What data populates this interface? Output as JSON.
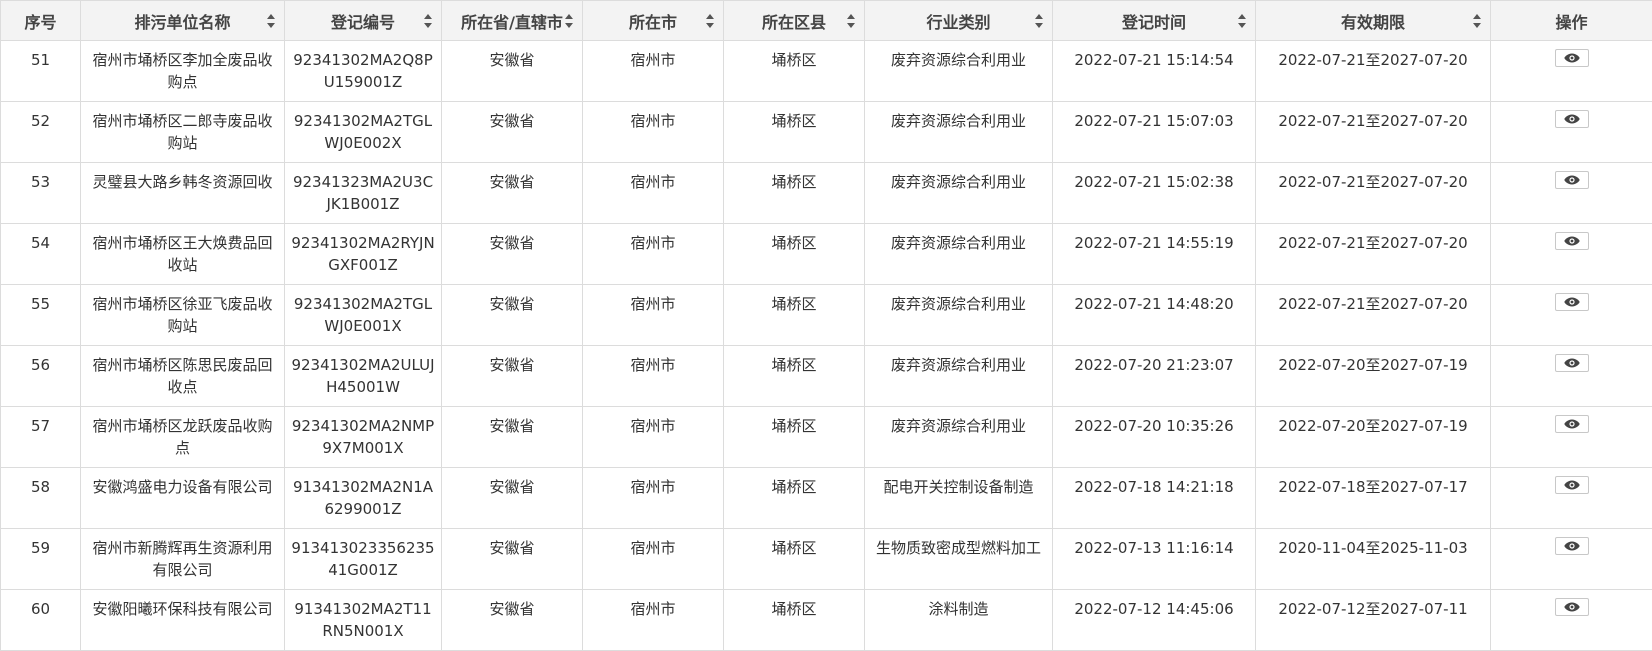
{
  "columns": [
    {
      "key": "seq",
      "label": "序号",
      "sortable": false
    },
    {
      "key": "name",
      "label": "排污单位名称",
      "sortable": true
    },
    {
      "key": "reg_no",
      "label": "登记编号",
      "sortable": true
    },
    {
      "key": "province",
      "label": "所在省/直辖市",
      "sortable": true
    },
    {
      "key": "city",
      "label": "所在市",
      "sortable": true
    },
    {
      "key": "district",
      "label": "所在区县",
      "sortable": true
    },
    {
      "key": "industry",
      "label": "行业类别",
      "sortable": true
    },
    {
      "key": "reg_time",
      "label": "登记时间",
      "sortable": true
    },
    {
      "key": "valid",
      "label": "有效期限",
      "sortable": true
    },
    {
      "key": "action",
      "label": "操作",
      "sortable": false
    }
  ],
  "icons": {
    "sort": "sort-updown-icon",
    "view": "eye-icon"
  },
  "rows": [
    {
      "seq": "51",
      "name": "宿州市埇桥区李加全废品收购点",
      "reg_no": "92341302MA2Q8PU159001Z",
      "province": "安徽省",
      "city": "宿州市",
      "district": "埇桥区",
      "industry": "废弃资源综合利用业",
      "reg_time": "2022-07-21 15:14:54",
      "valid": "2022-07-21至2027-07-20"
    },
    {
      "seq": "52",
      "name": "宿州市埇桥区二郎寺废品收购站",
      "reg_no": "92341302MA2TGLWJ0E002X",
      "province": "安徽省",
      "city": "宿州市",
      "district": "埇桥区",
      "industry": "废弃资源综合利用业",
      "reg_time": "2022-07-21 15:07:03",
      "valid": "2022-07-21至2027-07-20"
    },
    {
      "seq": "53",
      "name": "灵璧县大路乡韩冬资源回收",
      "reg_no": "92341323MA2U3CJK1B001Z",
      "province": "安徽省",
      "city": "宿州市",
      "district": "埇桥区",
      "industry": "废弃资源综合利用业",
      "reg_time": "2022-07-21 15:02:38",
      "valid": "2022-07-21至2027-07-20"
    },
    {
      "seq": "54",
      "name": "宿州市埇桥区王大焕费品回收站",
      "reg_no": "92341302MA2RYJNGXF001Z",
      "province": "安徽省",
      "city": "宿州市",
      "district": "埇桥区",
      "industry": "废弃资源综合利用业",
      "reg_time": "2022-07-21 14:55:19",
      "valid": "2022-07-21至2027-07-20"
    },
    {
      "seq": "55",
      "name": "宿州市埇桥区徐亚飞废品收购站",
      "reg_no": "92341302MA2TGLWJ0E001X",
      "province": "安徽省",
      "city": "宿州市",
      "district": "埇桥区",
      "industry": "废弃资源综合利用业",
      "reg_time": "2022-07-21 14:48:20",
      "valid": "2022-07-21至2027-07-20"
    },
    {
      "seq": "56",
      "name": "宿州市埇桥区陈思民废品回收点",
      "reg_no": "92341302MA2ULUJH45001W",
      "province": "安徽省",
      "city": "宿州市",
      "district": "埇桥区",
      "industry": "废弃资源综合利用业",
      "reg_time": "2022-07-20 21:23:07",
      "valid": "2022-07-20至2027-07-19"
    },
    {
      "seq": "57",
      "name": "宿州市埇桥区龙跃废品收购点",
      "reg_no": "92341302MA2NMP9X7M001X",
      "province": "安徽省",
      "city": "宿州市",
      "district": "埇桥区",
      "industry": "废弃资源综合利用业",
      "reg_time": "2022-07-20 10:35:26",
      "valid": "2022-07-20至2027-07-19"
    },
    {
      "seq": "58",
      "name": "安徽鸿盛电力设备有限公司",
      "reg_no": "91341302MA2N1A6299001Z",
      "province": "安徽省",
      "city": "宿州市",
      "district": "埇桥区",
      "industry": "配电开关控制设备制造",
      "reg_time": "2022-07-18 14:21:18",
      "valid": "2022-07-18至2027-07-17"
    },
    {
      "seq": "59",
      "name": "宿州市新腾辉再生资源利用有限公司",
      "reg_no": "91341302335623541G001Z",
      "province": "安徽省",
      "city": "宿州市",
      "district": "埇桥区",
      "industry": "生物质致密成型燃料加工",
      "reg_time": "2022-07-13 11:16:14",
      "valid": "2020-11-04至2025-11-03"
    },
    {
      "seq": "60",
      "name": "安徽阳曦环保科技有限公司",
      "reg_no": "91341302MA2T11RN5N001X",
      "province": "安徽省",
      "city": "宿州市",
      "district": "埇桥区",
      "industry": "涂料制造",
      "reg_time": "2022-07-12 14:45:06",
      "valid": "2022-07-12至2027-07-11"
    }
  ]
}
